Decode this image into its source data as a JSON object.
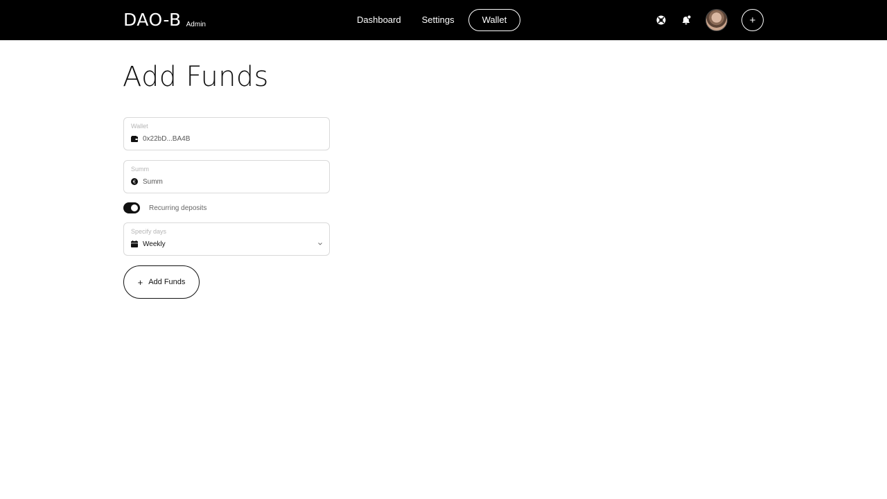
{
  "header": {
    "logo": "DAO-B",
    "logo_sub": "Admin",
    "nav": [
      {
        "label": "Dashboard"
      },
      {
        "label": "Settings"
      },
      {
        "label": "Wallet",
        "active": true
      }
    ],
    "icons": [
      "lifebuoy-icon",
      "bell-icon",
      "avatar",
      "plus-icon"
    ],
    "plus_symbol": "+"
  },
  "main": {
    "title": "Add Funds",
    "wallet": {
      "label": "Wallet",
      "value": "0x22bD...BA4B",
      "icon": "wallet-icon"
    },
    "summ": {
      "label": "Summ",
      "placeholder": "Summ",
      "icon": "euro-icon",
      "icon_glyph": "€"
    },
    "recurring": {
      "label": "Recurring deposits",
      "on": true
    },
    "days": {
      "label": "Specify days",
      "selected": "Weekly",
      "icon": "calendar-icon"
    },
    "submit": {
      "plus": "+",
      "label": "Add Funds"
    }
  },
  "colors": {
    "header_bg": "#000000",
    "accent": "#111111",
    "border": "#d9d9d9"
  }
}
